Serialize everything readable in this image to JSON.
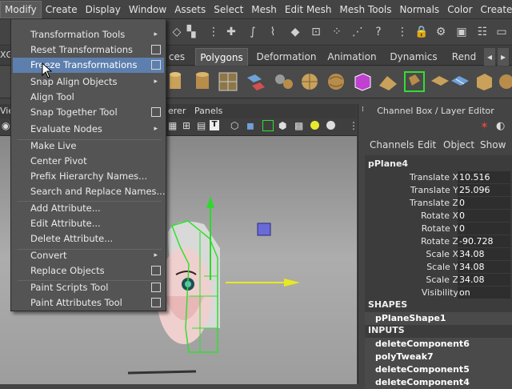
{
  "menubar": [
    "Modify",
    "Create",
    "Display",
    "Window",
    "Assets",
    "Select",
    "Mesh",
    "Edit Mesh",
    "Mesh Tools",
    "Normals",
    "Color",
    "Create UVs"
  ],
  "shelf_tabs": {
    "partial_left": "ces",
    "polygons": "Polygons",
    "deformation": "Deformation",
    "animation": "Animation",
    "dynamics": "Dynamics",
    "partial_right": "Rend"
  },
  "left_fragments": {
    "a": "XGe",
    "b": "Vie"
  },
  "viewport": {
    "menu_partial": "erer",
    "panels": "Panels"
  },
  "modify_menu": {
    "items": [
      {
        "label": "Transformation Tools",
        "submenu": true,
        "option": false
      },
      {
        "label": "Reset Transformations",
        "submenu": false,
        "option": true
      },
      {
        "label": "Freeze Transformations",
        "submenu": false,
        "option": true,
        "highlighted": true
      },
      {
        "label": "Snap Align Objects",
        "submenu": true,
        "option": false
      },
      {
        "label": "Align Tool",
        "submenu": false,
        "option": false
      },
      {
        "label": "Snap Together Tool",
        "submenu": false,
        "option": true
      },
      {
        "label": "Evaluate Nodes",
        "submenu": true,
        "option": false
      },
      {
        "label": "Make Live",
        "submenu": false,
        "option": false
      },
      {
        "label": "Center Pivot",
        "submenu": false,
        "option": false
      },
      {
        "label": "Prefix Hierarchy Names...",
        "submenu": false,
        "option": false
      },
      {
        "label": "Search and Replace Names...",
        "submenu": false,
        "option": false
      },
      {
        "label": "Add Attribute...",
        "submenu": false,
        "option": false
      },
      {
        "label": "Edit Attribute...",
        "submenu": false,
        "option": false
      },
      {
        "label": "Delete Attribute...",
        "submenu": false,
        "option": false
      },
      {
        "label": "Convert",
        "submenu": true,
        "option": false
      },
      {
        "label": "Replace Objects",
        "submenu": false,
        "option": true
      },
      {
        "label": "Paint Scripts Tool",
        "submenu": false,
        "option": true
      },
      {
        "label": "Paint Attributes Tool",
        "submenu": false,
        "option": true
      }
    ]
  },
  "channel_box": {
    "title": "Channel Box / Layer Editor",
    "menus": [
      "Channels",
      "Edit",
      "Object",
      "Show"
    ],
    "object": "pPlane4",
    "attributes": [
      {
        "name": "Translate X",
        "value": "10.516"
      },
      {
        "name": "Translate Y",
        "value": "25.096"
      },
      {
        "name": "Translate Z",
        "value": "0"
      },
      {
        "name": "Rotate X",
        "value": "0"
      },
      {
        "name": "Rotate Y",
        "value": "0"
      },
      {
        "name": "Rotate Z",
        "value": "-90.728"
      },
      {
        "name": "Scale X",
        "value": "34.08"
      },
      {
        "name": "Scale Y",
        "value": "34.08"
      },
      {
        "name": "Scale Z",
        "value": "34.08"
      },
      {
        "name": "Visibility",
        "value": "on"
      }
    ],
    "shapes_header": "SHAPES",
    "shape": "pPlaneShape1",
    "inputs_header": "INPUTS",
    "inputs": [
      "deleteComponent6",
      "polyTweak7",
      "deleteComponent5",
      "deleteComponent4"
    ]
  },
  "colors": {
    "menu_highlight": "#5d7fae",
    "viewport_top": "#7d7d7d",
    "viewport_bottom": "#adadad"
  }
}
